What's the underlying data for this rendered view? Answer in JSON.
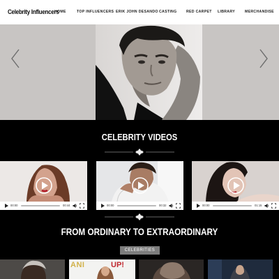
{
  "brand": {
    "logo": "Celebrity Influencers"
  },
  "nav": {
    "items": [
      {
        "label": "HOME"
      },
      {
        "label": "TOP INFLUENCERS"
      },
      {
        "label": "ERIK JOHN DESANDO"
      },
      {
        "label": "CASTING"
      },
      {
        "label": "RED CARPET"
      },
      {
        "label": "LIBRARY"
      },
      {
        "label": "MERCHANDISE"
      }
    ]
  },
  "hero": {
    "prev_icon": "chevron-left-icon",
    "next_icon": "chevron-right-icon"
  },
  "videos_section": {
    "title": "CELEBRITY VIDEOS",
    "videos": [
      {
        "current": "00:00",
        "duration": "00:44"
      },
      {
        "current": "00:00",
        "duration": "00:32"
      },
      {
        "current": "00:00",
        "duration": "01:15"
      }
    ]
  },
  "feature_section": {
    "title": "FROM ORDINARY TO EXTRAORDINARY",
    "badge": "CELEBRITIES",
    "card_texts": [
      "ANI",
      "UP!"
    ]
  },
  "colors": {
    "nav_bg": "#ffffff",
    "hero_bg": "#c8c5c3",
    "page_bg": "#000000",
    "badge_bg": "#7d7d7d"
  }
}
